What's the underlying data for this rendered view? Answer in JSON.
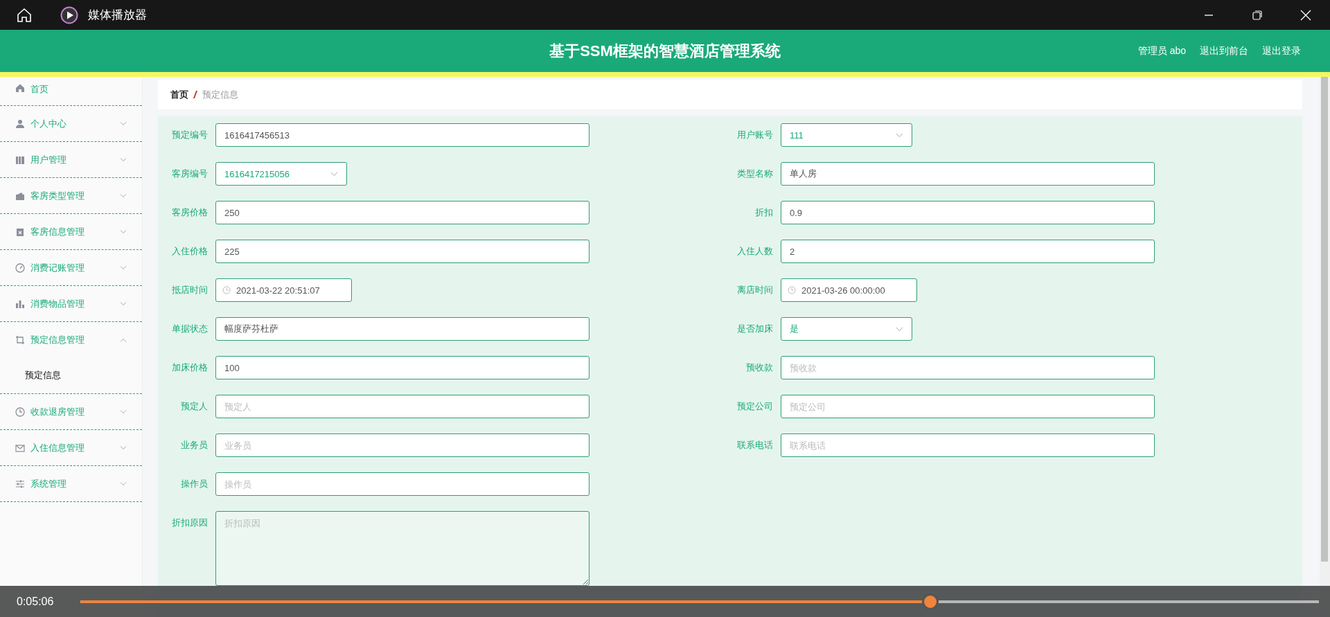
{
  "titlebar": {
    "title": "媒体播放器"
  },
  "header": {
    "title": "基于SSM框架的智慧酒店管理系统",
    "user": "管理员 abo",
    "links": [
      "退出到前台",
      "退出登录"
    ]
  },
  "sidebar": {
    "items": [
      {
        "label": "首页",
        "kind": "link"
      },
      {
        "label": "个人中心",
        "kind": "menu",
        "expanded": false
      },
      {
        "label": "用户管理",
        "kind": "menu",
        "expanded": false
      },
      {
        "label": "客房类型管理",
        "kind": "menu",
        "expanded": false
      },
      {
        "label": "客房信息管理",
        "kind": "menu",
        "expanded": false
      },
      {
        "label": "消费记账管理",
        "kind": "menu",
        "expanded": false
      },
      {
        "label": "消费物品管理",
        "kind": "menu",
        "expanded": false
      },
      {
        "label": "预定信息管理",
        "kind": "menu",
        "expanded": true,
        "children": [
          {
            "label": "预定信息"
          }
        ]
      },
      {
        "label": "收款退房管理",
        "kind": "menu",
        "expanded": false
      },
      {
        "label": "入住信息管理",
        "kind": "menu",
        "expanded": false
      },
      {
        "label": "系统管理",
        "kind": "menu",
        "expanded": false
      }
    ]
  },
  "breadcrumb": [
    "首页",
    "预定信息"
  ],
  "form": {
    "rows": [
      {
        "left": {
          "label": "预定编号",
          "kind": "text",
          "value": "1616417456513"
        },
        "right": {
          "label": "用户账号",
          "kind": "select",
          "value": "111"
        }
      },
      {
        "left": {
          "label": "客房编号",
          "kind": "select",
          "value": "1616417215056"
        },
        "right": {
          "label": "类型名称",
          "kind": "text",
          "value": "单人房"
        }
      },
      {
        "left": {
          "label": "客房价格",
          "kind": "text",
          "value": "250"
        },
        "right": {
          "label": "折扣",
          "kind": "text",
          "value": "0.9"
        }
      },
      {
        "left": {
          "label": "入住价格",
          "kind": "text",
          "value": "225"
        },
        "right": {
          "label": "入住人数",
          "kind": "text",
          "value": "2"
        }
      },
      {
        "left": {
          "label": "抵店时间",
          "kind": "date",
          "value": "2021-03-22 20:51:07"
        },
        "right": {
          "label": "离店时间",
          "kind": "date",
          "value": "2021-03-26 00:00:00"
        }
      },
      {
        "left": {
          "label": "单据状态",
          "kind": "text",
          "value": "幅度萨芬杜萨"
        },
        "right": {
          "label": "是否加床",
          "kind": "select",
          "value": "是"
        }
      },
      {
        "left": {
          "label": "加床价格",
          "kind": "text",
          "value": "100"
        },
        "right": {
          "label": "预收款",
          "kind": "text",
          "placeholder": "预收款"
        }
      },
      {
        "left": {
          "label": "预定人",
          "kind": "text",
          "placeholder": "预定人"
        },
        "right": {
          "label": "预定公司",
          "kind": "text",
          "placeholder": "预定公司"
        }
      },
      {
        "left": {
          "label": "业务员",
          "kind": "text",
          "placeholder": "业务员"
        },
        "right": {
          "label": "联系电话",
          "kind": "text",
          "placeholder": "联系电话"
        }
      },
      {
        "left": {
          "label": "操作员",
          "kind": "text",
          "placeholder": "操作员"
        }
      },
      {
        "left": {
          "label": "折扣原因",
          "kind": "textarea",
          "placeholder": "折扣原因"
        }
      }
    ]
  },
  "player": {
    "time": "0:05:06",
    "level": 0.686
  }
}
